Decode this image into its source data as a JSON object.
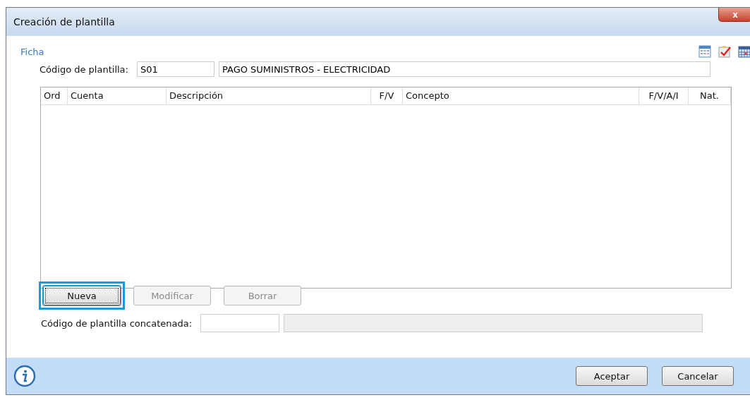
{
  "window": {
    "title": "Creación de plantilla",
    "close": "x"
  },
  "section": "Ficha",
  "template": {
    "label": "Código de plantilla:",
    "code": "S01",
    "description": "PAGO SUMINISTROS - ELECTRICIDAD"
  },
  "table": {
    "columns": [
      "Ord",
      "Cuenta",
      "Descripción",
      "F/V",
      "Concepto",
      "F/V/A/I",
      "Nat."
    ]
  },
  "buttons": [
    {
      "label": "Nueva",
      "disabled": false,
      "focused": true
    },
    {
      "label": "Modificar",
      "disabled": true,
      "focused": false
    },
    {
      "label": "Borrar",
      "disabled": true,
      "focused": false
    }
  ],
  "concat": {
    "label": "Código de plantilla concatenada:"
  },
  "footer": {
    "buttons": [
      "Aceptar",
      "Cancelar"
    ]
  }
}
